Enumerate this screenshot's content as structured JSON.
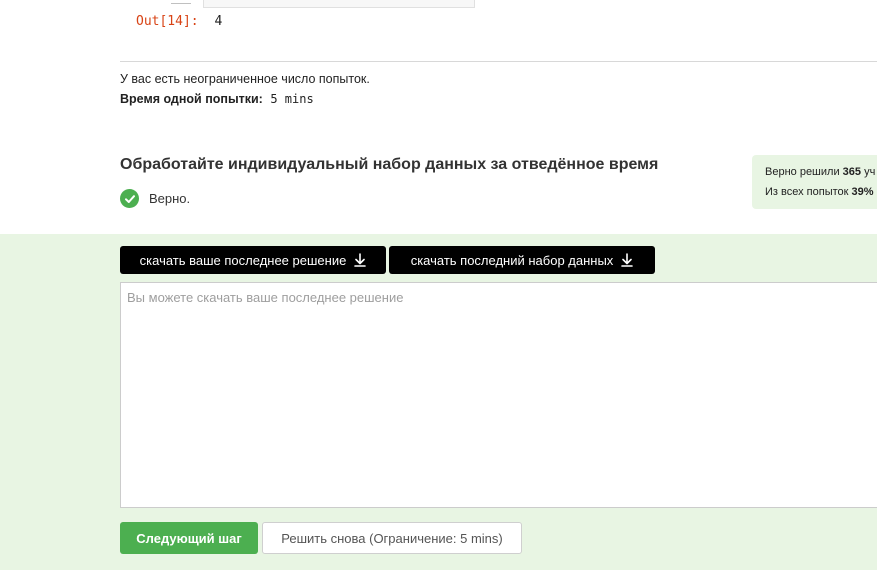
{
  "notebook": {
    "out_prompt": "Out[14]:",
    "out_value": "4"
  },
  "attempts": {
    "unlimited_text": "У вас есть неограниченное число попыток.",
    "time_label": "Время одной попытки:",
    "time_value": "5 mins"
  },
  "task": {
    "title": "Обработайте индивидуальный набор данных за отведённое время",
    "verdict": "Верно."
  },
  "stats": {
    "solved_prefix": "Верно решили ",
    "solved_count": "365",
    "solved_suffix": " уч",
    "attempts_prefix": "Из всех попыток ",
    "attempts_percent": "39%"
  },
  "actions": {
    "download_solution": "скачать ваше последнее решение",
    "download_dataset": "скачать последний набор данных",
    "solution_placeholder": "Вы можете скачать ваше последнее решение",
    "next_step": "Следующий шаг",
    "retry": "Решить снова (Ограничение: 5 mins)"
  },
  "colors": {
    "accent_green": "#4caf50",
    "panel_green": "#e8f5e3",
    "out_prompt": "#d84315"
  },
  "icons": {
    "check": "check-circle-icon",
    "download": "download-arrow-icon"
  }
}
